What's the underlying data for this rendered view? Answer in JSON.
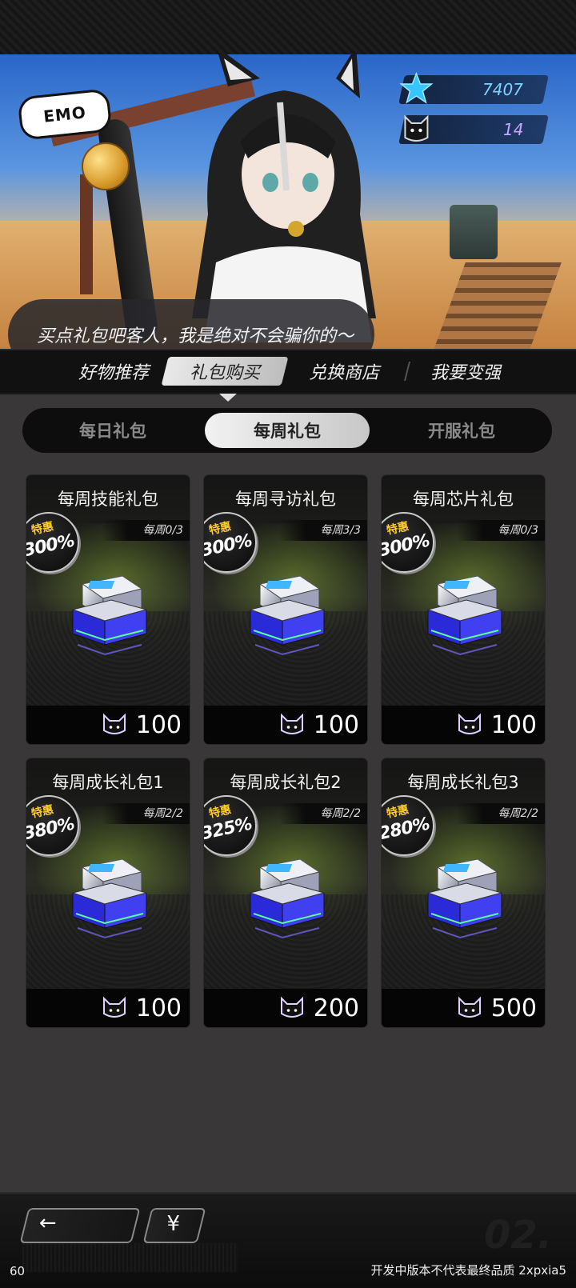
{
  "currency": {
    "stars": "7407",
    "cat_coins": "14"
  },
  "banner": {
    "dialog": "买点礼包吧客人，我是绝对不会骗你的～"
  },
  "nav": {
    "tabs": [
      {
        "label": "好物推荐",
        "active": false
      },
      {
        "label": "礼包购买",
        "active": true
      },
      {
        "label": "兑换商店",
        "active": false
      },
      {
        "label": "我要变强",
        "active": false
      }
    ]
  },
  "subtabs": [
    {
      "label": "每日礼包",
      "active": false
    },
    {
      "label": "每周礼包",
      "active": true
    },
    {
      "label": "开服礼包",
      "active": false
    }
  ],
  "packs": [
    {
      "title": "每周技能礼包",
      "limit": "每周0/3",
      "badge_tag": "特惠",
      "badge_pct": "300%",
      "price": "100"
    },
    {
      "title": "每周寻访礼包",
      "limit": "每周3/3",
      "badge_tag": "特惠",
      "badge_pct": "300%",
      "price": "100"
    },
    {
      "title": "每周芯片礼包",
      "limit": "每周0/3",
      "badge_tag": "特惠",
      "badge_pct": "300%",
      "price": "100"
    },
    {
      "title": "每周成长礼包1",
      "limit": "每周2/2",
      "badge_tag": "特惠",
      "badge_pct": "380%",
      "price": "100"
    },
    {
      "title": "每周成长礼包2",
      "limit": "每周2/2",
      "badge_tag": "特惠",
      "badge_pct": "325%",
      "price": "200"
    },
    {
      "title": "每周成长礼包3",
      "limit": "每周2/2",
      "badge_tag": "特惠",
      "badge_pct": "280%",
      "price": "500"
    }
  ],
  "bottom": {
    "back_icon": "←",
    "yen_icon": "¥",
    "fps": "60",
    "build_note": "开发中版本不代表最终品质 2xpxia5"
  },
  "colors": {
    "star": "#35c6ff",
    "badge_tag": "#ffcc2e",
    "active_tab": "#e9e9e9"
  }
}
